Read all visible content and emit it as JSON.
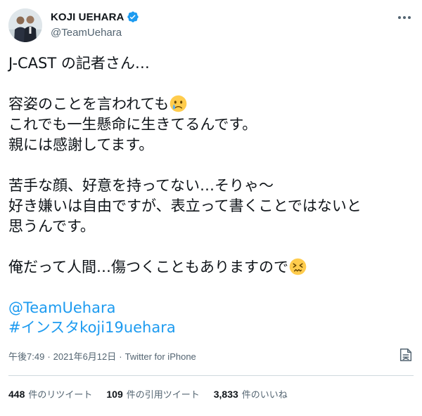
{
  "user": {
    "display_name": "KOJI UEHARA",
    "handle": "@TeamUehara",
    "verified": true
  },
  "tweet": {
    "lines": [
      "J-CAST の記者さん…",
      "",
      "容姿のことを言われても",
      "これでも一生懸命に生きてるんです。",
      "親には感謝してます。",
      "",
      "苦手な顔、好意を持ってない…そりゃ～",
      "好き嫌いは自由ですが、表立って書くことではないと",
      "思うんです。",
      "",
      "俺だって人間…傷つくこともありますので"
    ],
    "mention": "@TeamUehara",
    "hashtag": "#インスタkoji19uehara"
  },
  "meta": {
    "time": "午後7:49",
    "date": "2021年6月12日",
    "separator": "·",
    "source": "Twitter for iPhone"
  },
  "stats": {
    "retweets": {
      "count": "448",
      "label": "件のリツイート"
    },
    "quotes": {
      "count": "109",
      "label": "件の引用ツイート"
    },
    "likes": {
      "count": "3,833",
      "label": "件のいいね"
    }
  },
  "icons": {
    "verified": "verified-badge-icon",
    "crying_emoji": "crying-face-emoji",
    "persevering_emoji": "persevering-face-emoji",
    "more": "more-icon",
    "translate": "translate-icon"
  },
  "colors": {
    "link": "#1d9bf0",
    "secondary_text": "#536471",
    "divider": "#cfd9de"
  }
}
